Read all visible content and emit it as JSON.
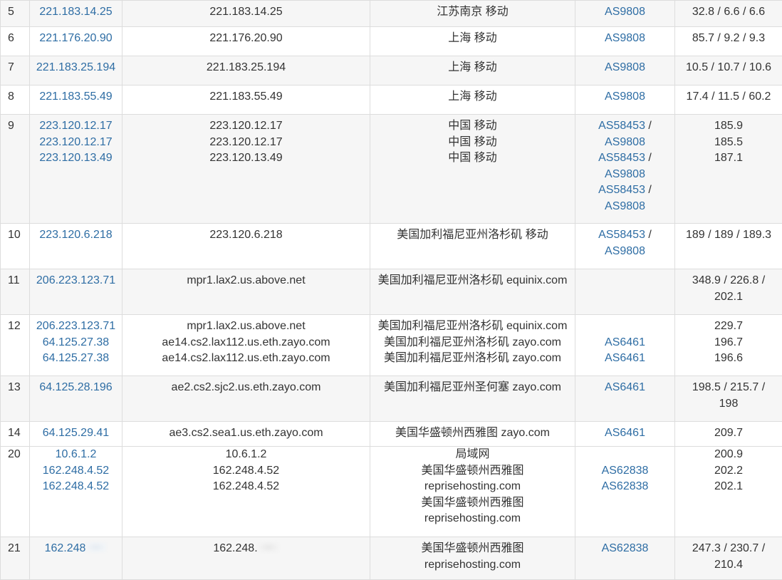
{
  "rows": [
    {
      "hop": "5",
      "ips": [
        "221.183.14.25"
      ],
      "hosts": [
        "221.183.14.25"
      ],
      "locations": [
        "江苏南京 移动"
      ],
      "asns": [
        "AS9808"
      ],
      "latency": "32.8 / 6.6 / 6.6"
    },
    {
      "hop": "6",
      "ips": [
        "221.176.20.90"
      ],
      "hosts": [
        "221.176.20.90"
      ],
      "locations": [
        "上海 移动"
      ],
      "asns": [
        "AS9808"
      ],
      "latency": "85.7 / 9.2 / 9.3"
    },
    {
      "hop": "7",
      "ips": [
        "221.183.25.194"
      ],
      "hosts": [
        "221.183.25.194"
      ],
      "locations": [
        "上海 移动"
      ],
      "asns": [
        "AS9808"
      ],
      "latency": "10.5 / 10.7 / 10.6"
    },
    {
      "hop": "8",
      "ips": [
        "221.183.55.49"
      ],
      "hosts": [
        "221.183.55.49"
      ],
      "locations": [
        "上海 移动"
      ],
      "asns": [
        "AS9808"
      ],
      "latency": "17.4 / 11.5 / 60.2"
    },
    {
      "hop": "9",
      "ips": [
        "223.120.12.17",
        "223.120.12.17",
        "223.120.13.49"
      ],
      "hosts": [
        "223.120.12.17",
        "223.120.12.17",
        "223.120.13.49"
      ],
      "locations": [
        "中国 移动",
        "中国 移动",
        "中国 移动"
      ],
      "asns": [
        [
          "AS58453",
          "AS9808"
        ],
        [
          "AS58453",
          "AS9808"
        ],
        [
          "AS58453",
          "AS9808"
        ]
      ],
      "latency_lines": [
        "185.9",
        "185.5",
        "187.1"
      ]
    },
    {
      "hop": "10",
      "ips": [
        "223.120.6.218"
      ],
      "hosts": [
        "223.120.6.218"
      ],
      "locations": [
        "美国加利福尼亚州洛杉矶 移动"
      ],
      "asns": [
        [
          "AS58453",
          "AS9808"
        ]
      ],
      "latency": "189 / 189 / 189.3"
    },
    {
      "hop": "11",
      "ips": [
        "206.223.123.71"
      ],
      "hosts": [
        "mpr1.lax2.us.above.net"
      ],
      "locations": [
        "美国加利福尼亚州洛杉矶 equinix.com"
      ],
      "asns": [],
      "latency_lines": [
        "348.9 / 226.8 /",
        "202.1"
      ]
    },
    {
      "hop": "12",
      "ips": [
        "206.223.123.71",
        "64.125.27.38",
        "64.125.27.38"
      ],
      "hosts": [
        "mpr1.lax2.us.above.net",
        "ae14.cs2.lax112.us.eth.zayo.com",
        "ae14.cs2.lax112.us.eth.zayo.com"
      ],
      "locations": [
        "美国加利福尼亚州洛杉矶 equinix.com",
        "美国加利福尼亚州洛杉矶 zayo.com",
        "美国加利福尼亚州洛杉矶 zayo.com"
      ],
      "asns": [
        "",
        "AS6461",
        "AS6461"
      ],
      "latency_lines": [
        "229.7",
        "196.7",
        "196.6"
      ]
    },
    {
      "hop": "13",
      "ips": [
        "64.125.28.196"
      ],
      "hosts": [
        "ae2.cs2.sjc2.us.eth.zayo.com"
      ],
      "locations": [
        "美国加利福尼亚州圣何塞 zayo.com"
      ],
      "asns": [
        "AS6461"
      ],
      "latency_lines": [
        "198.5 / 215.7 /",
        "198"
      ]
    },
    {
      "hop": "14",
      "ips": [
        "64.125.29.41"
      ],
      "hosts": [
        "ae3.cs2.sea1.us.eth.zayo.com"
      ],
      "locations": [
        "美国华盛顿州西雅图 zayo.com"
      ],
      "asns": [
        "AS6461"
      ],
      "latency": "209.7"
    },
    {
      "hop": "20",
      "ips": [
        "10.6.1.2",
        "162.248.4.52",
        "162.248.4.52"
      ],
      "hosts": [
        "10.6.1.2",
        "162.248.4.52",
        "162.248.4.52"
      ],
      "locations": [
        "局域网",
        "美国华盛顿州西雅图",
        "reprisehosting.com",
        "美国华盛顿州西雅图",
        "reprisehosting.com"
      ],
      "asns": [
        "",
        "AS62838",
        "AS62838"
      ],
      "latency_lines": [
        "200.9",
        "202.2",
        "202.1"
      ]
    },
    {
      "hop": "21",
      "ips": [
        "162.248"
      ],
      "hosts": [
        "162.248."
      ],
      "locations": [
        "美国华盛顿州西雅图",
        "reprisehosting.com"
      ],
      "asns": [
        "AS62838"
      ],
      "latency_lines": [
        "247.3 / 230.7 /",
        "210.4"
      ]
    }
  ]
}
